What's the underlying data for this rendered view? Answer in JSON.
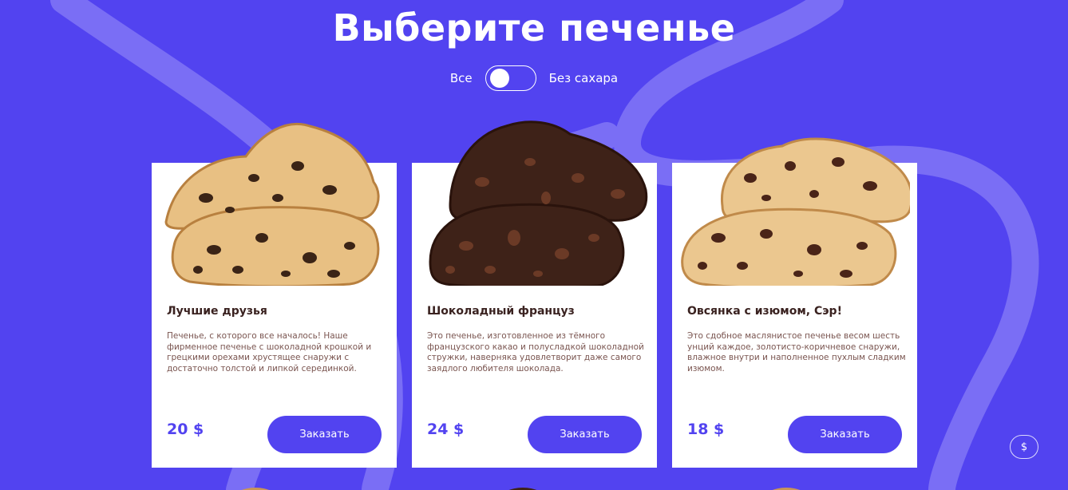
{
  "page": {
    "title": "Выберите печенье"
  },
  "filter": {
    "left_label": "Все",
    "right_label": "Без сахара",
    "sugar_free_enabled": false
  },
  "cards": [
    {
      "name": "Лучшие друзья",
      "description": "Печенье, с которого все началось! Наше фирменное печенье с шоколадной крошкой и грецкими орехами хрустящее снаружи с достаточно толстой и липкой серединкой.",
      "price": "20 $",
      "button_label": "Заказать",
      "cookie_color": "#e8c083",
      "cookie_shade": "#b8803f",
      "chip_color": "#3b2416"
    },
    {
      "name": "Шоколадный француз",
      "description": "Это печенье, изготовленное из тёмного французского какао и полусладкой шоколадной стружки, наверняка удовлетворит даже самого заядлого любителя шоколада.",
      "price": "24 $",
      "button_label": "Заказать",
      "cookie_color": "#3e2218",
      "cookie_shade": "#2a130c",
      "chip_color": "#6b3a26"
    },
    {
      "name": "Овсянка с изюмом, Сэр!",
      "description": "Это сдобное маслянистое печенье весом шесть унций каждое, золотисто-коричневое снаружи, влажное внутри и наполненное пухлым сладким изюмом.",
      "price": "18 $",
      "button_label": "Заказать",
      "cookie_color": "#ebc78f",
      "cookie_shade": "#c08a4a",
      "chip_color": "#4a2418"
    }
  ],
  "currency_button": {
    "symbol": "$"
  },
  "colors": {
    "background": "#5243f0",
    "accent": "#5243f0",
    "swirl": "#7a6ef5"
  }
}
